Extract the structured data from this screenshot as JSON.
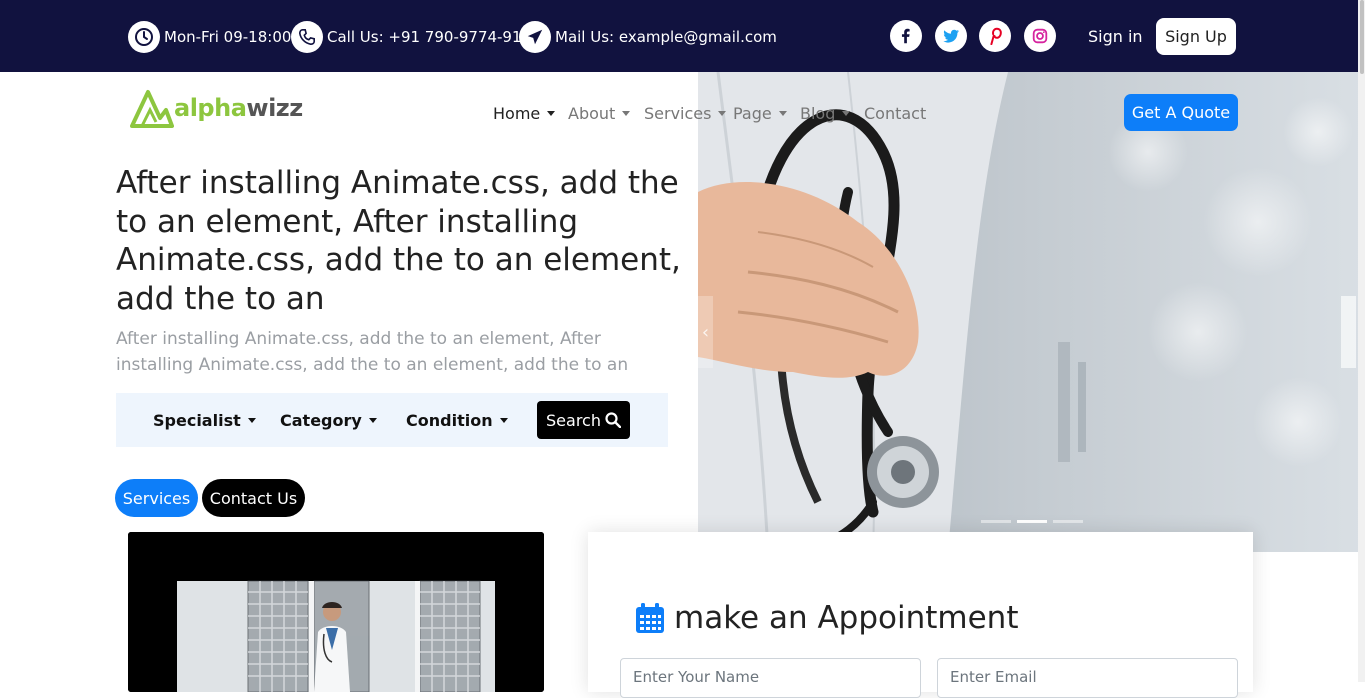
{
  "topbar": {
    "hours": "Mon-Fri 09-18:00",
    "phone": "Call Us: +91 790-9774-918",
    "mail": "Mail Us: example@gmail.com",
    "social": [
      "facebook-icon",
      "twitter-icon",
      "pinterest-icon",
      "instagram-icon"
    ],
    "signin": "Sign in",
    "signup": "Sign Up"
  },
  "brand": {
    "part1": "alpha",
    "part2": "wizz"
  },
  "nav": {
    "items": [
      {
        "label": "Home",
        "dropdown": true
      },
      {
        "label": "About",
        "dropdown": true
      },
      {
        "label": "Services",
        "dropdown": true
      },
      {
        "label": "Page",
        "dropdown": true
      },
      {
        "label": "Blog",
        "dropdown": true
      },
      {
        "label": "Contact",
        "dropdown": false
      }
    ],
    "quote": "Get A Quote"
  },
  "hero": {
    "title": "After installing Animate.css, add the to an element, After installing Animate.css, add the to an element, add the to an",
    "subtitle": "After installing Animate.css, add the to an element, After installing Animate.css, add the to an element, add the to an",
    "filters": [
      "Specialist",
      "Category",
      "Condition"
    ],
    "search": "Search",
    "btn_services": "Services",
    "btn_contact": "Contact Us"
  },
  "carousel": {
    "slides": 3,
    "active": 2
  },
  "appointment": {
    "title": "make an Appointment",
    "name_placeholder": "Enter Your Name",
    "email_placeholder": "Enter Email"
  },
  "colors": {
    "topbar": "#11123f",
    "primary": "#0d7ef9",
    "brand_green": "#8dc63f"
  }
}
